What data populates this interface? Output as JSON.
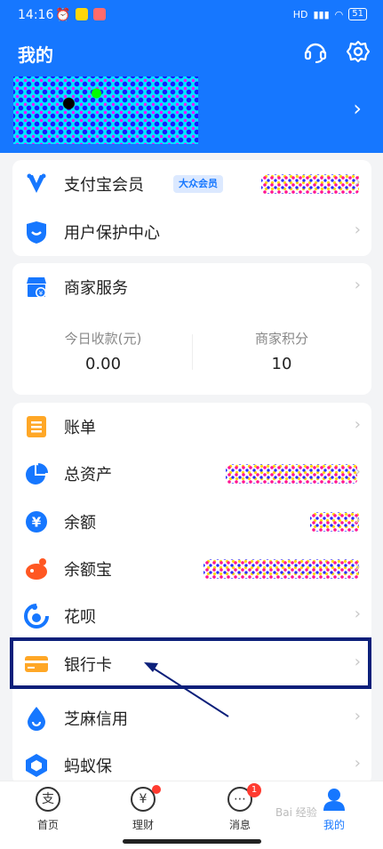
{
  "status_bar": {
    "time": "14:16",
    "battery": "51",
    "network": "HD"
  },
  "header": {
    "title": "我的"
  },
  "card1": {
    "member": {
      "label": "支付宝会员",
      "badge": "大众会员"
    },
    "protect": {
      "label": "用户保护中心"
    }
  },
  "merchant": {
    "label": "商家服务",
    "today_label": "今日收款(元)",
    "today_value": "0.00",
    "points_label": "商家积分",
    "points_value": "10"
  },
  "menu": {
    "bill": "账单",
    "assets": "总资产",
    "balance": "余额",
    "yuebao": "余额宝",
    "huabei": "花呗",
    "bankcard": "银行卡",
    "zhima": "芝麻信用",
    "mayibao": "蚂蚁保"
  },
  "tabs": {
    "home": "首页",
    "wealth": "理财",
    "wealth_icon": "¥",
    "messages": "消息",
    "messages_count": "1",
    "mine": "我的"
  },
  "watermark": "Bai 经验",
  "colors": {
    "brand": "#1677ff",
    "orange": "#ffa726",
    "highlight": "#0b1f7a"
  }
}
